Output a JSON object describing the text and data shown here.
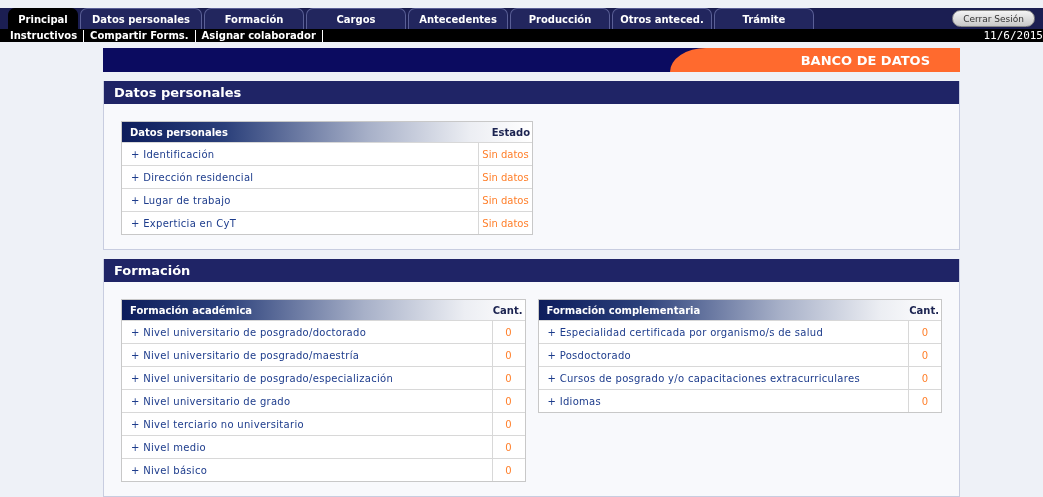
{
  "tabs": [
    {
      "label": "Principal",
      "selected": true
    },
    {
      "label": "Datos personales",
      "selected": false
    },
    {
      "label": "Formación",
      "selected": false
    },
    {
      "label": "Cargos",
      "selected": false
    },
    {
      "label": "Antecedentes",
      "selected": false
    },
    {
      "label": "Producción",
      "selected": false
    },
    {
      "label": "Otros anteced.",
      "selected": false
    },
    {
      "label": "Trámite",
      "selected": false
    }
  ],
  "logout_button": "Cerrar Sesión",
  "sub_menu": [
    "Instructivos",
    "Compartir Forms.",
    "Asignar colaborador"
  ],
  "date": "11/6/2015",
  "banner": "BANCO DE DATOS",
  "sections": [
    {
      "title": "Datos personales",
      "tables": [
        {
          "heading": "Datos personales",
          "value_heading": "Estado",
          "rows": [
            {
              "label": "+ Identificación",
              "value": "Sin datos"
            },
            {
              "label": "+ Dirección residencial",
              "value": "Sin datos"
            },
            {
              "label": "+ Lugar de trabajo",
              "value": "Sin datos"
            },
            {
              "label": "+ Experticia en CyT",
              "value": "Sin datos"
            }
          ]
        }
      ]
    },
    {
      "title": "Formación",
      "tables": [
        {
          "heading": "Formación académica",
          "value_heading": "Cant.",
          "rows": [
            {
              "label": "+ Nivel universitario de posgrado/doctorado",
              "value": "0"
            },
            {
              "label": "+ Nivel universitario de posgrado/maestría",
              "value": "0"
            },
            {
              "label": "+ Nivel universitario de posgrado/especialización",
              "value": "0"
            },
            {
              "label": "+ Nivel universitario de grado",
              "value": "0"
            },
            {
              "label": "+ Nivel terciario no universitario",
              "value": "0"
            },
            {
              "label": "+ Nivel medio",
              "value": "0"
            },
            {
              "label": "+ Nivel básico",
              "value": "0"
            }
          ]
        },
        {
          "heading": "Formación complementaria",
          "value_heading": "Cant.",
          "rows": [
            {
              "label": "+ Especialidad certificada por organismo/s de salud",
              "value": "0"
            },
            {
              "label": "+ Posdoctorado",
              "value": "0"
            },
            {
              "label": "+ Cursos de posgrado y/o capacitaciones extracurriculares",
              "value": "0"
            },
            {
              "label": "+ Idiomas",
              "value": "0"
            }
          ]
        }
      ]
    }
  ]
}
